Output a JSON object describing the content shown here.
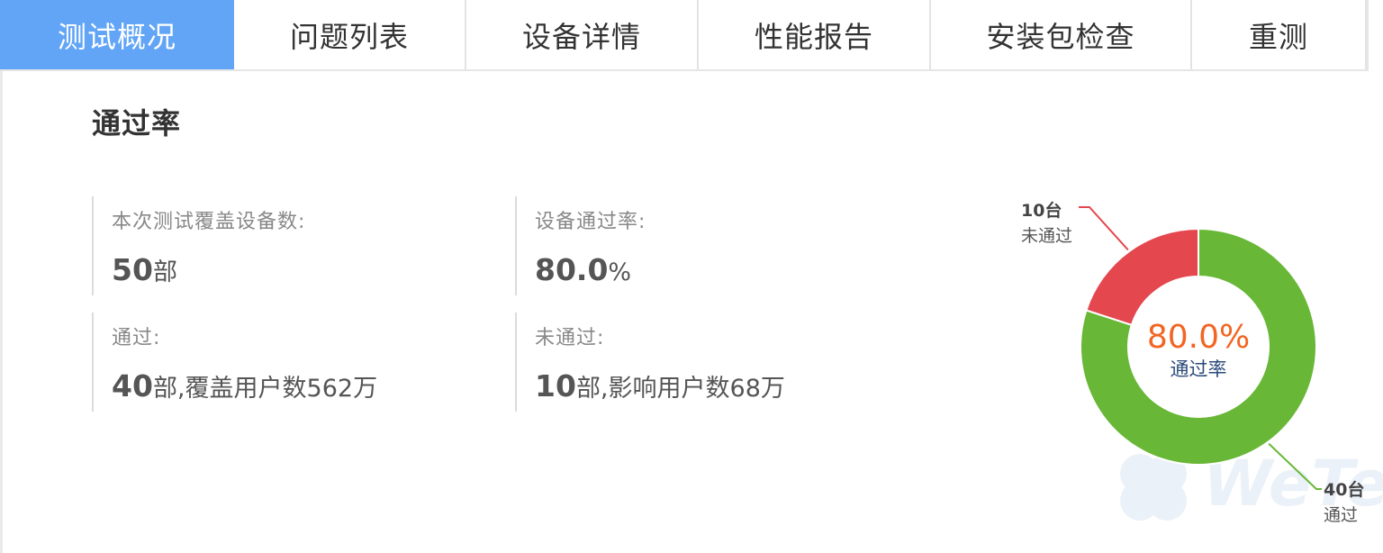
{
  "tabs": [
    {
      "label": "测试概况",
      "active": true
    },
    {
      "label": "问题列表",
      "active": false
    },
    {
      "label": "设备详情",
      "active": false
    },
    {
      "label": "性能报告",
      "active": false
    },
    {
      "label": "安装包检查",
      "active": false
    },
    {
      "label": "重测",
      "active": false
    }
  ],
  "section": {
    "title": "通过率"
  },
  "stats": {
    "cover": {
      "label": "本次测试覆盖设备数:",
      "value": "50",
      "unit": "部"
    },
    "rate": {
      "label": "设备通过率:",
      "value": "80.0",
      "unit": "%"
    },
    "pass": {
      "label": "通过:",
      "value": "40",
      "unit": "部,",
      "extra": "覆盖用户数562万"
    },
    "fail": {
      "label": "未通过:",
      "value": "10",
      "unit": "部,",
      "extra": "影响用户数68万"
    }
  },
  "chart_data": {
    "type": "pie",
    "categories": [
      "未通过",
      "通过"
    ],
    "values": [
      10,
      40
    ],
    "slice_labels": [
      {
        "count": "10台",
        "name": "未通过"
      },
      {
        "count": "40台",
        "name": "通过"
      }
    ],
    "center_value": "80.0%",
    "center_label": "通过率",
    "colors": [
      "#e5474f",
      "#68b737"
    ]
  },
  "colors": {
    "accent": "#62a5f7",
    "highlight": "#f26522",
    "pass": "#68b737",
    "fail": "#e5474f"
  },
  "watermark": {
    "text": "WeTest"
  }
}
